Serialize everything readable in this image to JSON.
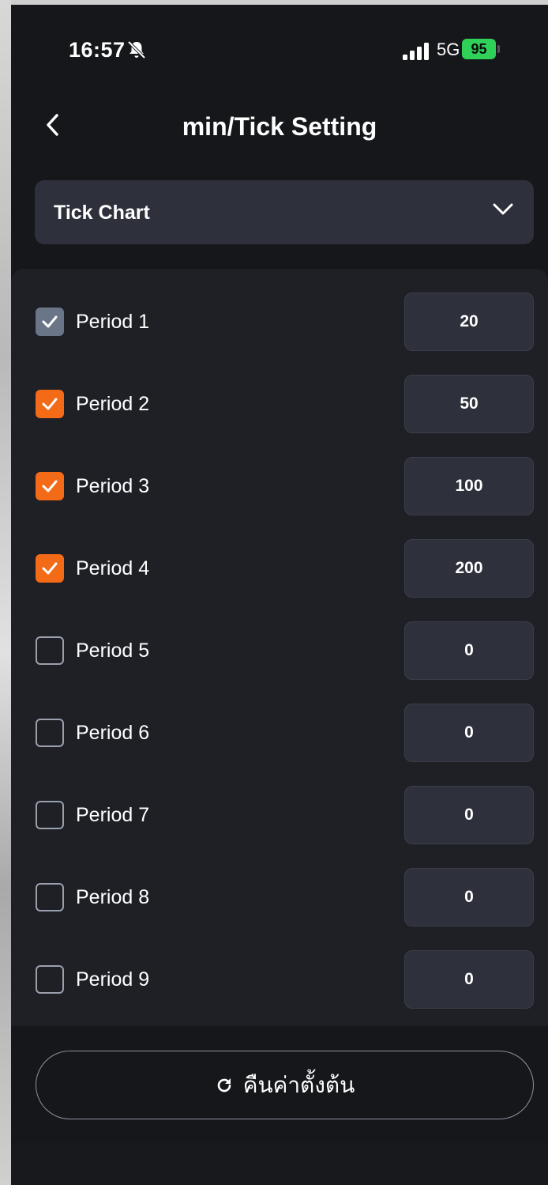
{
  "status_bar": {
    "time": "16:57",
    "network": "5G",
    "battery": "95"
  },
  "header": {
    "title": "min/Tick Setting"
  },
  "dropdown": {
    "selected": "Tick Chart"
  },
  "periods": [
    {
      "label": "Period 1",
      "value": "20",
      "checked": true,
      "check_color": "#6b7588"
    },
    {
      "label": "Period 2",
      "value": "50",
      "checked": true,
      "check_color": "#f36a17"
    },
    {
      "label": "Period 3",
      "value": "100",
      "checked": true,
      "check_color": "#f36a17"
    },
    {
      "label": "Period 4",
      "value": "200",
      "checked": true,
      "check_color": "#f36a17"
    },
    {
      "label": "Period 5",
      "value": "0",
      "checked": false
    },
    {
      "label": "Period 6",
      "value": "0",
      "checked": false
    },
    {
      "label": "Period 7",
      "value": "0",
      "checked": false
    },
    {
      "label": "Period 8",
      "value": "0",
      "checked": false
    },
    {
      "label": "Period 9",
      "value": "0",
      "checked": false
    }
  ],
  "footer": {
    "reset_label": "คืนค่าตั้งต้น"
  },
  "colors": {
    "background": "#15171b",
    "accent": "#f36a17",
    "panel": "#1e2026",
    "input": "#2e313c"
  },
  "icons": [
    "bell-off-icon",
    "signal-icon",
    "back-icon",
    "chevron-down-icon",
    "check-icon",
    "refresh-icon"
  ]
}
